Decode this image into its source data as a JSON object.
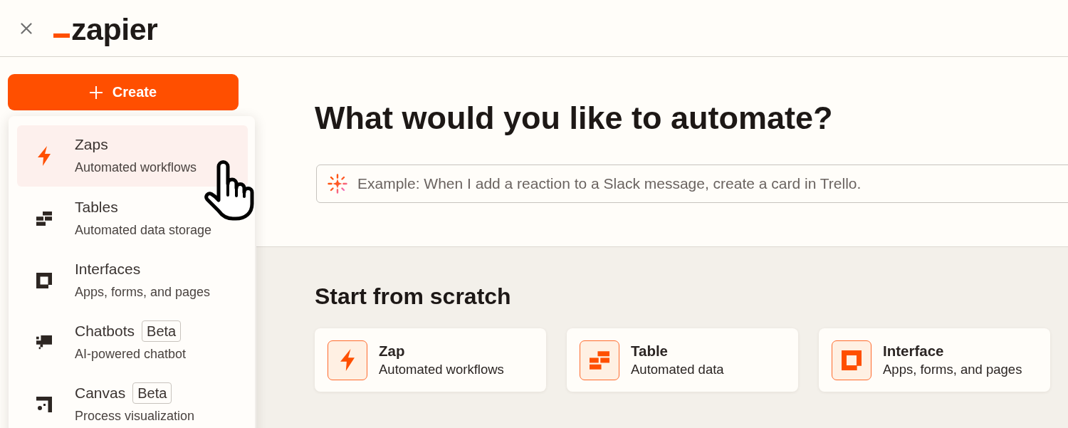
{
  "header": {
    "logo": "zapier"
  },
  "create_button": {
    "label": "Create"
  },
  "create_menu": {
    "items": [
      {
        "kind": "zap",
        "title": "Zaps",
        "description": "Automated workflows",
        "selected": true
      },
      {
        "kind": "table",
        "title": "Tables",
        "description": "Automated data storage",
        "selected": false
      },
      {
        "kind": "interface",
        "title": "Interfaces",
        "description": "Apps, forms, and pages",
        "selected": false
      },
      {
        "kind": "chatbot",
        "title": "Chatbots",
        "badge": "Beta",
        "description": "AI-powered chatbot",
        "selected": false
      },
      {
        "kind": "canvas",
        "title": "Canvas",
        "badge": "Beta",
        "description": "Process visualization",
        "selected": false
      }
    ]
  },
  "prompt": {
    "heading": "What would you like to automate?",
    "placeholder": "Example: When I add a reaction to a Slack message, create a card in Trello."
  },
  "start_from_scratch": {
    "heading": "Start from scratch",
    "cards": [
      {
        "kind": "zap",
        "title": "Zap",
        "description": "Automated workflows"
      },
      {
        "kind": "table",
        "title": "Table",
        "description": "Automated data"
      },
      {
        "kind": "interface",
        "title": "Interface",
        "description": "Apps, forms, and pages"
      }
    ]
  }
}
